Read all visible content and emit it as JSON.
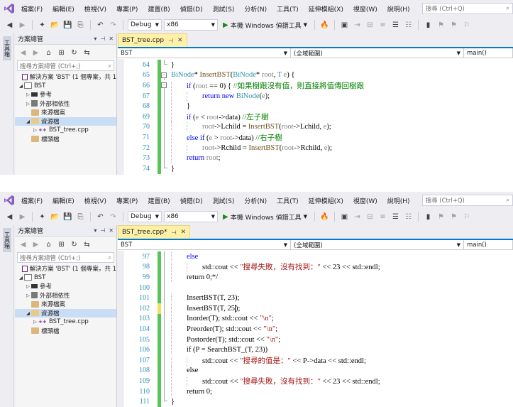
{
  "menu": [
    "檔案(F)",
    "編輯(E)",
    "檢視(V)",
    "專案(P)",
    "建置(B)",
    "偵錯(D)",
    "測試(S)",
    "分析(N)",
    "工具(T)",
    "延伸模組(X)",
    "視窗(W)",
    "說明(H)"
  ],
  "search_placeholder": "搜尋 (Ctrl+Q)",
  "toolbar": {
    "config": "Debug",
    "platform": "x86",
    "run_label": "本機 Windows 偵錯工具"
  },
  "side_strip_tab": "工具箱",
  "solution_explorer": {
    "title": "方案總管",
    "search_placeholder": "搜尋方案總管 (Ctrl+;)",
    "tree": [
      {
        "label": "解決方案 'BST' (1 個專案，共 1",
        "level": 0,
        "icon": "solution-icon",
        "twisty": ""
      },
      {
        "label": "BST",
        "level": 0,
        "icon": "project-icon",
        "twisty": "◢"
      },
      {
        "label": "參考",
        "level": 1,
        "icon": "references-icon",
        "twisty": "▷"
      },
      {
        "label": "外部相依性",
        "level": 1,
        "icon": "dependencies-icon",
        "twisty": "▷"
      },
      {
        "label": "來源檔案",
        "level": 1,
        "icon": "folder-icon",
        "twisty": ""
      },
      {
        "label": "資源檔",
        "level": 1,
        "icon": "folder-open-icon",
        "twisty": "◢"
      },
      {
        "label": "BST_tree.cpp",
        "level": 2,
        "icon": "cpp-file-icon",
        "twisty": "▷"
      },
      {
        "label": "標頭檔",
        "level": 1,
        "icon": "folder-icon",
        "twisty": ""
      }
    ]
  },
  "pane1": {
    "tab_label": "BST_tree.cpp",
    "nav_project": "BST",
    "nav_scope": "(全域範圍)",
    "nav_member": "main()",
    "lines": [
      {
        "n": "64",
        "indent": 0,
        "parts": [
          [
            "p",
            "}"
          ]
        ],
        "outline": "end",
        "bar": "green"
      },
      {
        "n": "65",
        "indent": 0,
        "parts": [
          [
            "ty",
            "BiNode"
          ],
          [
            "p",
            "* "
          ],
          [
            "fn",
            "InsertBST"
          ],
          [
            "p",
            "("
          ],
          [
            "ty",
            "BiNode"
          ],
          [
            "p",
            "* "
          ],
          [
            "pv",
            "root"
          ],
          [
            "p",
            ", "
          ],
          [
            "ty",
            "T"
          ],
          [
            "p",
            " "
          ],
          [
            "pv",
            "e"
          ],
          [
            "p",
            ") {"
          ]
        ],
        "outline": "box",
        "bar": "green"
      },
      {
        "n": "66",
        "indent": 1,
        "parts": [
          [
            "kw",
            "if"
          ],
          [
            "p",
            " ("
          ],
          [
            "pv",
            "root"
          ],
          [
            "p",
            " == 0) { "
          ],
          [
            "cm",
            "//如果樹跟沒有值，則直接將值傳回樹跟"
          ]
        ],
        "outline": "box",
        "bar": "green"
      },
      {
        "n": "67",
        "indent": 2,
        "parts": [
          [
            "kw",
            "return new "
          ],
          [
            "ty",
            "BiNode"
          ],
          [
            "p",
            "("
          ],
          [
            "pv",
            "e"
          ],
          [
            "p",
            ");"
          ]
        ],
        "outline": "line",
        "bar": "green"
      },
      {
        "n": "68",
        "indent": 1,
        "parts": [
          [
            "p",
            "}"
          ]
        ],
        "outline": "line",
        "bar": "green"
      },
      {
        "n": "69",
        "indent": 1,
        "parts": [
          [
            "kw",
            "if"
          ],
          [
            "p",
            " ("
          ],
          [
            "pv",
            "e"
          ],
          [
            "p",
            " < "
          ],
          [
            "pv",
            "root"
          ],
          [
            "p",
            "->data) "
          ],
          [
            "cm",
            "//左子樹"
          ]
        ],
        "outline": "line",
        "bar": "green"
      },
      {
        "n": "70",
        "indent": 2,
        "parts": [
          [
            "pv",
            "root"
          ],
          [
            "p",
            "->Lchild = "
          ],
          [
            "fn",
            "InsertBST"
          ],
          [
            "p",
            "("
          ],
          [
            "pv",
            "root"
          ],
          [
            "p",
            "->Lchild, "
          ],
          [
            "pv",
            "e"
          ],
          [
            "p",
            ");"
          ]
        ],
        "outline": "line",
        "bar": "green"
      },
      {
        "n": "71",
        "indent": 1,
        "parts": [
          [
            "kw",
            "else if"
          ],
          [
            "p",
            " ("
          ],
          [
            "pv",
            "e"
          ],
          [
            "p",
            " > "
          ],
          [
            "pv",
            "root"
          ],
          [
            "p",
            "->data) "
          ],
          [
            "cm",
            "//右子樹"
          ]
        ],
        "outline": "line",
        "bar": "green"
      },
      {
        "n": "72",
        "indent": 2,
        "parts": [
          [
            "pv",
            "root"
          ],
          [
            "p",
            "->Rchild = "
          ],
          [
            "fn",
            "InsertBST"
          ],
          [
            "p",
            "("
          ],
          [
            "pv",
            "root"
          ],
          [
            "p",
            "->Rchild, "
          ],
          [
            "pv",
            "e"
          ],
          [
            "p",
            ");"
          ]
        ],
        "outline": "line",
        "bar": "green"
      },
      {
        "n": "73",
        "indent": 1,
        "parts": [
          [
            "kw",
            "return "
          ],
          [
            "pv",
            "root"
          ],
          [
            "p",
            ";"
          ]
        ],
        "outline": "line",
        "bar": "green"
      },
      {
        "n": "74",
        "indent": 0,
        "parts": [
          [
            "p",
            "}"
          ]
        ],
        "outline": "end",
        "bar": "green"
      }
    ]
  },
  "pane2": {
    "tab_label": "BST_tree.cpp*",
    "nav_project": "BST",
    "nav_scope": "(全域範圍)",
    "nav_member": "main()",
    "lines": [
      {
        "n": "97",
        "indent": 1,
        "parts": [
          [
            "kw",
            "else"
          ]
        ],
        "outline": "line",
        "bar": "green"
      },
      {
        "n": "98",
        "indent": 2,
        "parts": [
          [
            "p",
            "std::cout << "
          ],
          [
            "st",
            "\"搜尋失敗，沒有找到：\""
          ],
          [
            "p",
            " << 23 << std::endl;"
          ]
        ],
        "outline": "line",
        "bar": "green"
      },
      {
        "n": "99",
        "indent": 1,
        "parts": [
          [
            "p",
            "return 0;*/"
          ]
        ],
        "outline": "line",
        "bar": "green"
      },
      {
        "n": "100",
        "indent": 0,
        "parts": [],
        "outline": "line",
        "bar": "green"
      },
      {
        "n": "101",
        "indent": 1,
        "parts": [
          [
            "p",
            "InsertBST(T, 23);"
          ]
        ],
        "outline": "line",
        "bar": "green"
      },
      {
        "n": "102",
        "indent": 1,
        "parts": [
          [
            "p",
            "InsertBST(T, 25"
          ],
          [
            "caret",
            ""
          ],
          [
            "p",
            ");"
          ]
        ],
        "outline": "line",
        "bar": "yellow"
      },
      {
        "n": "103",
        "indent": 1,
        "parts": [
          [
            "p",
            "Inorder(T); std::cout << "
          ],
          [
            "st",
            "\"\\n\""
          ],
          [
            "p",
            ";"
          ]
        ],
        "outline": "line",
        "bar": "green"
      },
      {
        "n": "104",
        "indent": 1,
        "parts": [
          [
            "p",
            "Preorder(T); std::cout << "
          ],
          [
            "st",
            "\"\\n\""
          ],
          [
            "p",
            ";"
          ]
        ],
        "outline": "line",
        "bar": "green"
      },
      {
        "n": "105",
        "indent": 1,
        "parts": [
          [
            "p",
            "Postorder(T); std::cout << "
          ],
          [
            "st",
            "\"\\n\""
          ],
          [
            "p",
            ";"
          ]
        ],
        "outline": "line",
        "bar": "green"
      },
      {
        "n": "106",
        "indent": 1,
        "parts": [
          [
            "p",
            "if (P = SearchBST_(T, 23))"
          ]
        ],
        "outline": "line",
        "bar": "green"
      },
      {
        "n": "107",
        "indent": 2,
        "parts": [
          [
            "p",
            "std::cout << "
          ],
          [
            "st",
            "\"搜尋的值是：\""
          ],
          [
            "p",
            " << P->data << std::endl;"
          ]
        ],
        "outline": "line",
        "bar": "green"
      },
      {
        "n": "108",
        "indent": 1,
        "parts": [
          [
            "p",
            "else"
          ]
        ],
        "outline": "line",
        "bar": "green"
      },
      {
        "n": "109",
        "indent": 2,
        "parts": [
          [
            "p",
            "std::cout << "
          ],
          [
            "st",
            "\"搜尋失敗，沒有找到：\""
          ],
          [
            "p",
            " << 23 << std::endl;"
          ]
        ],
        "outline": "line",
        "bar": "green"
      },
      {
        "n": "110",
        "indent": 1,
        "parts": [
          [
            "p",
            "return 0;"
          ]
        ],
        "outline": "line",
        "bar": "green"
      },
      {
        "n": "111",
        "indent": 0,
        "parts": [
          [
            "p",
            "}"
          ]
        ],
        "outline": "end",
        "bar": "green"
      }
    ]
  },
  "colors": {
    "accent": "#007acc",
    "tab_modified": "#fff0a8",
    "change_saved": "#57c459",
    "change_unsaved": "#efe160",
    "line_number": "#2b91af"
  }
}
